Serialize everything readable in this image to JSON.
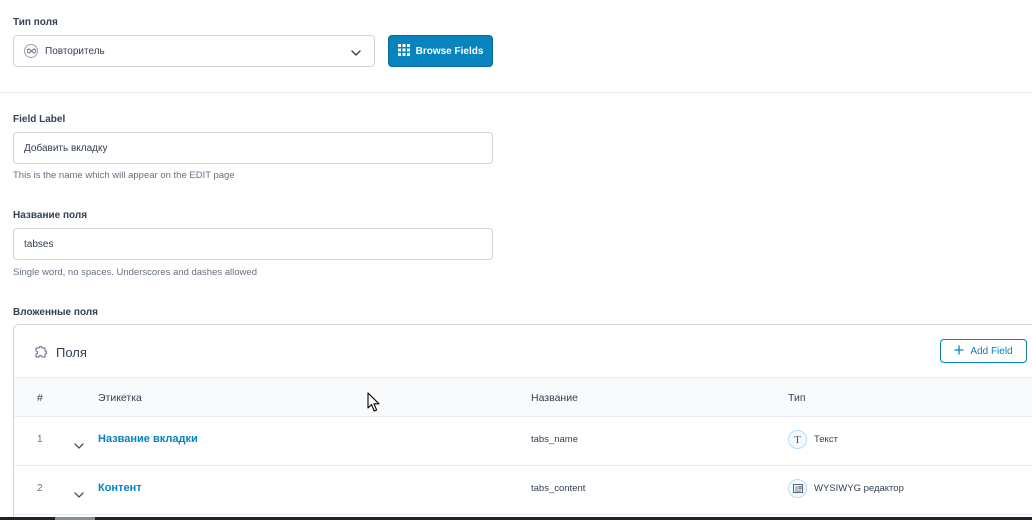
{
  "field_type": {
    "label": "Тип поля",
    "selected": "Повторитель",
    "icon": "repeater-icon",
    "browse_button": "Browse Fields"
  },
  "field_label": {
    "label": "Field Label",
    "value": "Добавить вкладку",
    "hint": "This is the name which will appear on the EDIT page"
  },
  "field_name": {
    "label": "Название поля",
    "value": "tabses",
    "hint": "Single word, no spaces. Underscores and dashes allowed"
  },
  "sub_fields": {
    "label": "Вложенные поля",
    "panel_title": "Поля",
    "add_button": "Add Field",
    "columns": [
      "#",
      "Этикетка",
      "Название",
      "Тип"
    ],
    "rows": [
      {
        "num": "1",
        "label": "Название вкладки",
        "name": "tabs_name",
        "type": "Текст",
        "type_icon": "text-type-icon"
      },
      {
        "num": "2",
        "label": "Контент",
        "name": "tabs_content",
        "type": "WYSIWYG редактор",
        "type_icon": "wysiwyg-type-icon"
      }
    ]
  },
  "colors": {
    "accent": "#0783be",
    "border": "#d0d5dd",
    "text": "#344054"
  }
}
